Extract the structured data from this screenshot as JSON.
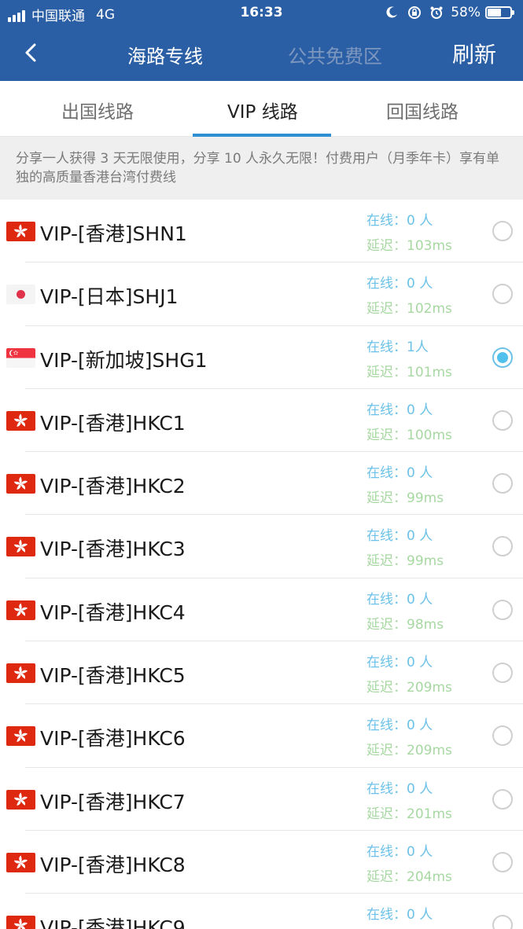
{
  "status_bar": {
    "carrier": "中国联通",
    "network": "4G",
    "time": "16:33",
    "battery_percent": "58%",
    "icons": [
      "signal-icon",
      "moon-icon",
      "lock-rotation-icon",
      "alarm-icon",
      "battery-icon"
    ]
  },
  "navbar": {
    "title": "海路专线",
    "secondary_title": "公共免费区",
    "refresh_label": "刷新",
    "back_icon": "chevron-left-icon"
  },
  "tabs": [
    {
      "label": "出国线路",
      "active": false
    },
    {
      "label": "VIP 线路",
      "active": true
    },
    {
      "label": "回国线路",
      "active": false
    }
  ],
  "notice": "分享一人获得 3 天无限使用，分享 10 人永久无限！付费用户（月季年卡）享有单独的高质量香港台湾付费线",
  "servers": [
    {
      "flag": "hk",
      "name": "VIP-[香港]SHN1",
      "online": "在线：0 人",
      "latency": "延迟：103ms",
      "selected": false
    },
    {
      "flag": "jp",
      "name": "VIP-[日本]SHJ1",
      "online": "在线：0 人",
      "latency": "延迟：102ms",
      "selected": false
    },
    {
      "flag": "sg",
      "name": "VIP-[新加坡]SHG1",
      "online": "在线：1人",
      "latency": "延迟：101ms",
      "selected": true
    },
    {
      "flag": "hk",
      "name": "VIP-[香港]HKC1",
      "online": "在线：0 人",
      "latency": "延迟：100ms",
      "selected": false
    },
    {
      "flag": "hk",
      "name": "VIP-[香港]HKC2",
      "online": "在线：0 人",
      "latency": "延迟：99ms",
      "selected": false
    },
    {
      "flag": "hk",
      "name": "VIP-[香港]HKC3",
      "online": "在线：0 人",
      "latency": "延迟：99ms",
      "selected": false
    },
    {
      "flag": "hk",
      "name": "VIP-[香港]HKC4",
      "online": "在线：0 人",
      "latency": "延迟：98ms",
      "selected": false
    },
    {
      "flag": "hk",
      "name": "VIP-[香港]HKC5",
      "online": "在线：0 人",
      "latency": "延迟：209ms",
      "selected": false
    },
    {
      "flag": "hk",
      "name": "VIP-[香港]HKC6",
      "online": "在线：0 人",
      "latency": "延迟：209ms",
      "selected": false
    },
    {
      "flag": "hk",
      "name": "VIP-[香港]HKC7",
      "online": "在线：0 人",
      "latency": "延迟：201ms",
      "selected": false
    },
    {
      "flag": "hk",
      "name": "VIP-[香港]HKC8",
      "online": "在线：0 人",
      "latency": "延迟：204ms",
      "selected": false
    },
    {
      "flag": "hk",
      "name": "VIP-[香港]HKC9",
      "online": "在线：0 人",
      "latency": "",
      "selected": false
    }
  ],
  "colors": {
    "header_bg": "#2b5fa5",
    "tab_underline": "#2e8fd3",
    "online_text": "#6cc1e8",
    "latency_text": "#a7d8a2",
    "radio_selected": "#4fc1ec"
  }
}
